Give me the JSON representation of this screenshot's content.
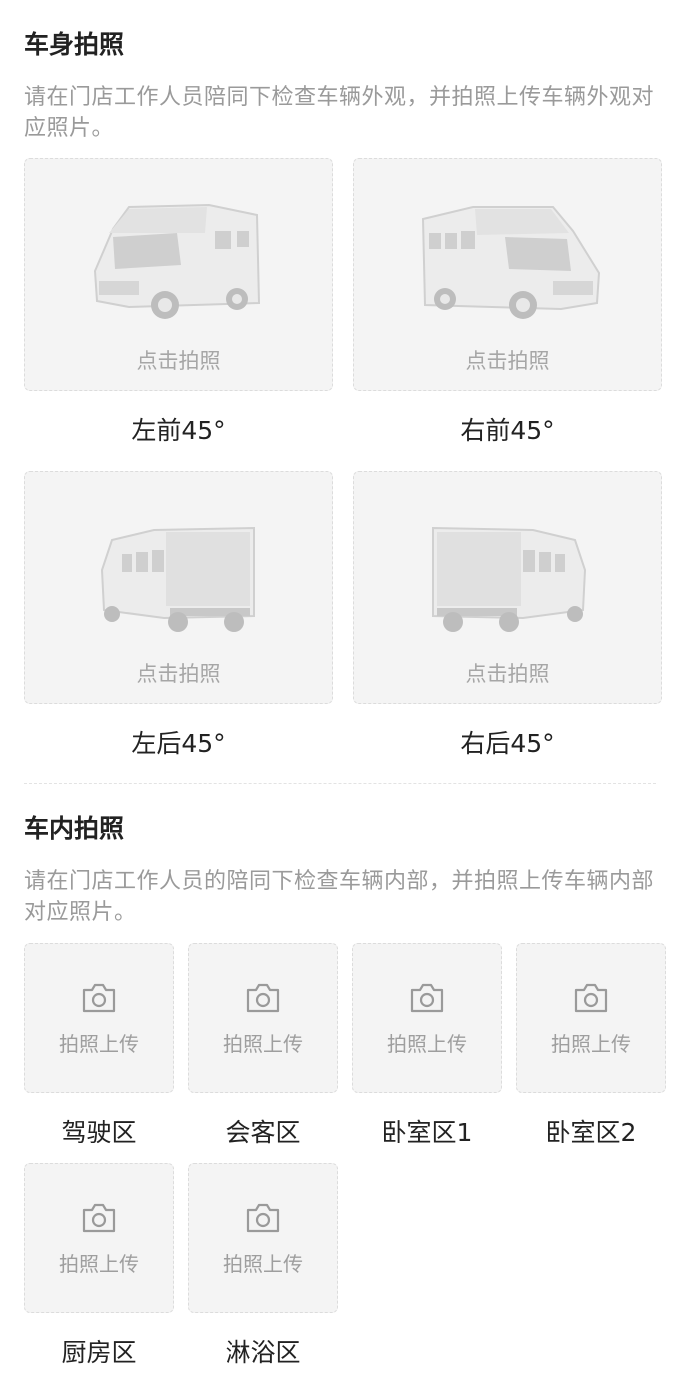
{
  "exterior": {
    "title": "车身拍照",
    "description": "请在门店工作人员陪同下检查车辆外观，并拍照上传车辆外观对应照片。",
    "cards": [
      {
        "label": "左前45°",
        "hint": "点击拍照",
        "view": "front-left"
      },
      {
        "label": "右前45°",
        "hint": "点击拍照",
        "view": "front-right"
      },
      {
        "label": "左后45°",
        "hint": "点击拍照",
        "view": "rear-left"
      },
      {
        "label": "右后45°",
        "hint": "点击拍照",
        "view": "rear-right"
      }
    ]
  },
  "interior": {
    "title": "车内拍照",
    "description": "请在门店工作人员的陪同下检查车辆内部，并拍照上传车辆内部对应照片。",
    "cards": [
      {
        "label": "驾驶区",
        "hint": "拍照上传"
      },
      {
        "label": "会客区",
        "hint": "拍照上传"
      },
      {
        "label": "卧室区1",
        "hint": "拍照上传"
      },
      {
        "label": "卧室区2",
        "hint": "拍照上传"
      },
      {
        "label": "厨房区",
        "hint": "拍照上传"
      },
      {
        "label": "淋浴区",
        "hint": "拍照上传"
      }
    ]
  }
}
